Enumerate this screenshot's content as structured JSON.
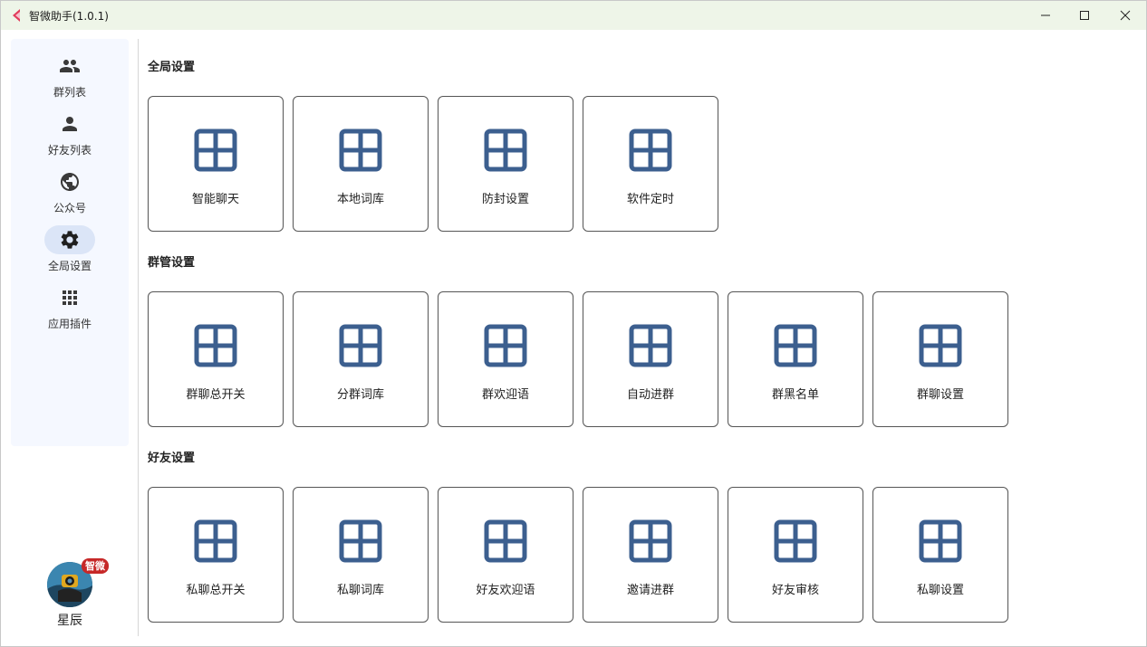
{
  "window": {
    "title": "智微助手(1.0.1)",
    "controls": [
      "minimize",
      "maximize",
      "close"
    ]
  },
  "sidebar": {
    "items": [
      {
        "label": "群列表",
        "icon": "group-icon",
        "active": false
      },
      {
        "label": "好友列表",
        "icon": "person-icon",
        "active": false
      },
      {
        "label": "公众号",
        "icon": "globe-icon",
        "active": false
      },
      {
        "label": "全局设置",
        "icon": "gear-icon",
        "active": true
      },
      {
        "label": "应用插件",
        "icon": "apps-grid-icon",
        "active": false
      }
    ]
  },
  "profile": {
    "badge": "智微",
    "name": "星辰"
  },
  "sections": [
    {
      "title": "全局设置",
      "cards": [
        "智能聊天",
        "本地词库",
        "防封设置",
        "软件定时"
      ]
    },
    {
      "title": "群管设置",
      "cards": [
        "群聊总开关",
        "分群词库",
        "群欢迎语",
        "自动进群",
        "群黑名单",
        "群聊设置"
      ]
    },
    {
      "title": "好友设置",
      "cards": [
        "私聊总开关",
        "私聊词库",
        "好友欢迎语",
        "邀请进群",
        "好友审核",
        "私聊设置"
      ]
    }
  ],
  "colors": {
    "titlebar_bg": "#eef5e8",
    "sidebar_bg": "#f5f8ff",
    "active_nav_bg": "#dbe5f7",
    "card_icon": "#3c5f8f"
  }
}
